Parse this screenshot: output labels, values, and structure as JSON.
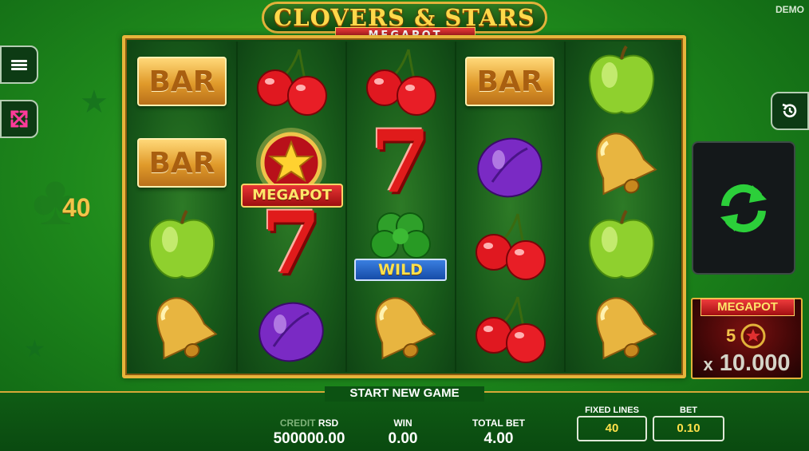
{
  "header": {
    "title": "CLOVERS & STARS",
    "subtitle": "MEGAPOT",
    "mode_label": "DEMO"
  },
  "left": {
    "line_number": "40"
  },
  "reels": {
    "symbols": [
      [
        "bar",
        "bar",
        "apple",
        "bell"
      ],
      [
        "cherry",
        "megapot-star",
        "seven",
        "plum"
      ],
      [
        "cherry",
        "seven",
        "clover-wild",
        "bell"
      ],
      [
        "bar",
        "plum",
        "cherry",
        "cherry"
      ],
      [
        "apple",
        "bell",
        "apple",
        "bell"
      ]
    ],
    "bar_label": "BAR",
    "wild_label": "WILD",
    "megapot_symbol_label": "MEGAPOT",
    "seven_label": "7"
  },
  "megapot_panel": {
    "title": "MEGAPOT",
    "count": "5",
    "multiplier_prefix": "x",
    "multiplier_value": "10.000"
  },
  "footer": {
    "start_new_game": "START NEW GAME",
    "credit_label": "CREDIT",
    "credit_currency": "RSD",
    "credit_value": "500000.00",
    "win_label": "WIN",
    "win_value": "0.00",
    "total_bet_label": "TOTAL BET",
    "total_bet_value": "4.00",
    "fixed_lines_label": "FIXED LINES",
    "fixed_lines_value": "40",
    "bet_label": "BET",
    "bet_value": "0.10"
  },
  "colors": {
    "background": "#1f8a1c",
    "reel_frame": "#e7b43b",
    "accent_gold": "#f3c44a",
    "value_yellow": "#ffe14a",
    "spin_green": "#2ccf3a",
    "megapot_red": "#a30f12"
  }
}
